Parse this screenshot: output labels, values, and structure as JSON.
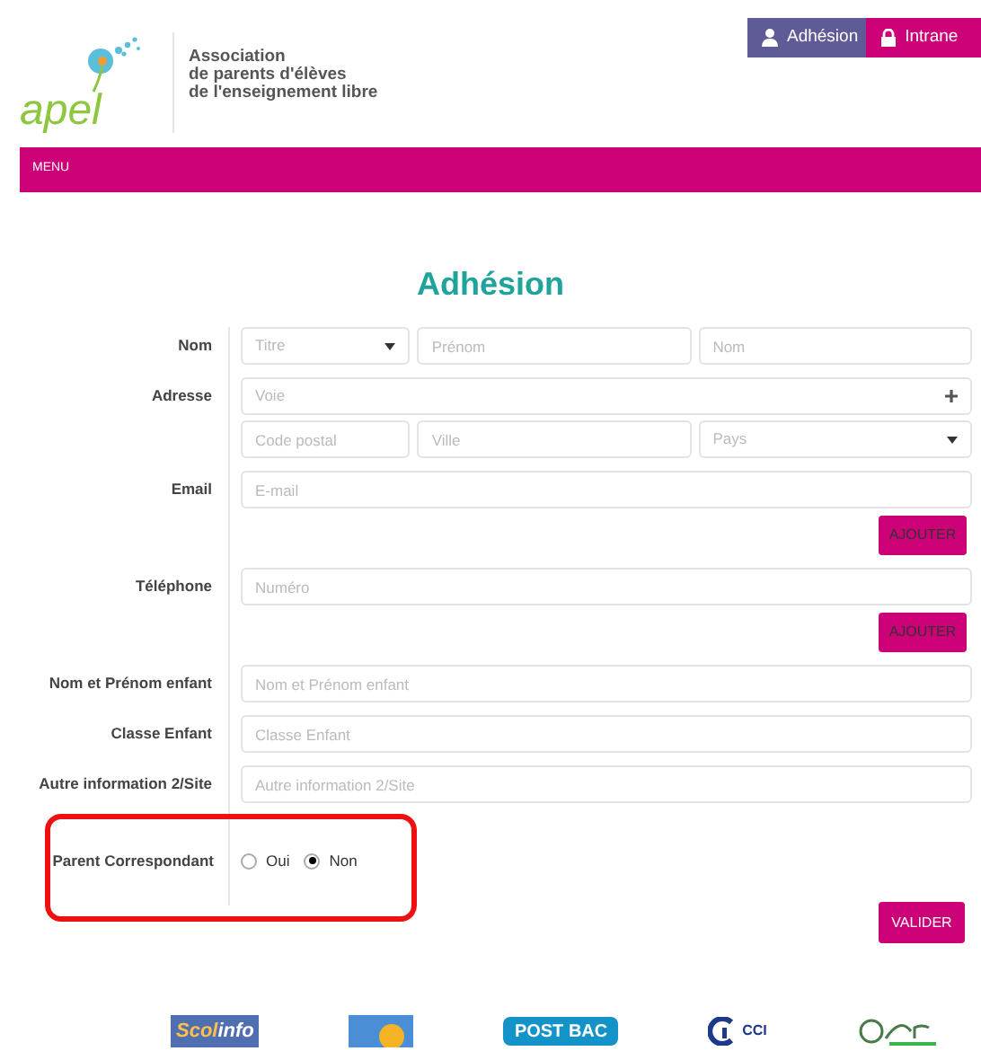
{
  "header": {
    "logo_text": "apel",
    "org_name": [
      "Association",
      "de parents d'élèves",
      "de l'enseignement libre"
    ],
    "top_buttons": [
      {
        "kind": "user",
        "label": "Adhésion"
      },
      {
        "kind": "lock",
        "label": "Intrane"
      }
    ]
  },
  "menu": {
    "label": "MENU"
  },
  "form": {
    "title": "Adhésion",
    "rows": [
      {
        "label": "Nom",
        "lines": [
          [
            {
              "kind": "select",
              "placeholder": "Titre"
            },
            {
              "kind": "text",
              "placeholder": "Prénom"
            },
            {
              "kind": "text",
              "placeholder": "Nom"
            }
          ]
        ]
      },
      {
        "label": "Adresse",
        "lines": [
          [
            {
              "kind": "plus",
              "placeholder": "Voie"
            }
          ],
          [
            {
              "kind": "text",
              "placeholder": "Code postal"
            },
            {
              "kind": "text",
              "placeholder": "Ville"
            },
            {
              "kind": "select",
              "placeholder": "Pays"
            }
          ]
        ]
      },
      {
        "label": "Email",
        "lines": [
          [
            {
              "kind": "text",
              "placeholder": "E-mail"
            }
          ]
        ],
        "button": "AJOUTER"
      },
      {
        "label": "Téléphone",
        "lines": [
          [
            {
              "kind": "text",
              "placeholder": "Numéro"
            }
          ]
        ],
        "button": "AJOUTER"
      },
      {
        "label": "Nom et Prénom enfant",
        "lines": [
          [
            {
              "kind": "text",
              "placeholder": "Nom et Prénom enfant"
            }
          ]
        ]
      },
      {
        "label": "Classe Enfant",
        "lines": [
          [
            {
              "kind": "text",
              "placeholder": "Classe Enfant"
            }
          ]
        ]
      },
      {
        "label": "Autre information 2/Site",
        "lines": [
          [
            {
              "kind": "text",
              "placeholder": "Autre information 2/Site"
            }
          ]
        ]
      }
    ],
    "radio_row": {
      "label": "Parent Correspondant",
      "options": [
        {
          "label": "Oui",
          "selected": false
        },
        {
          "label": "Non",
          "selected": true
        }
      ]
    },
    "submit": "VALIDER"
  },
  "partners": [
    {
      "kind": "scolinfo",
      "parts": [
        "Scol",
        "info"
      ]
    },
    {
      "kind": "academie"
    },
    {
      "kind": "postbac",
      "text": "POST BAC"
    },
    {
      "kind": "cci",
      "text": "CCI"
    },
    {
      "kind": "oser"
    }
  ]
}
